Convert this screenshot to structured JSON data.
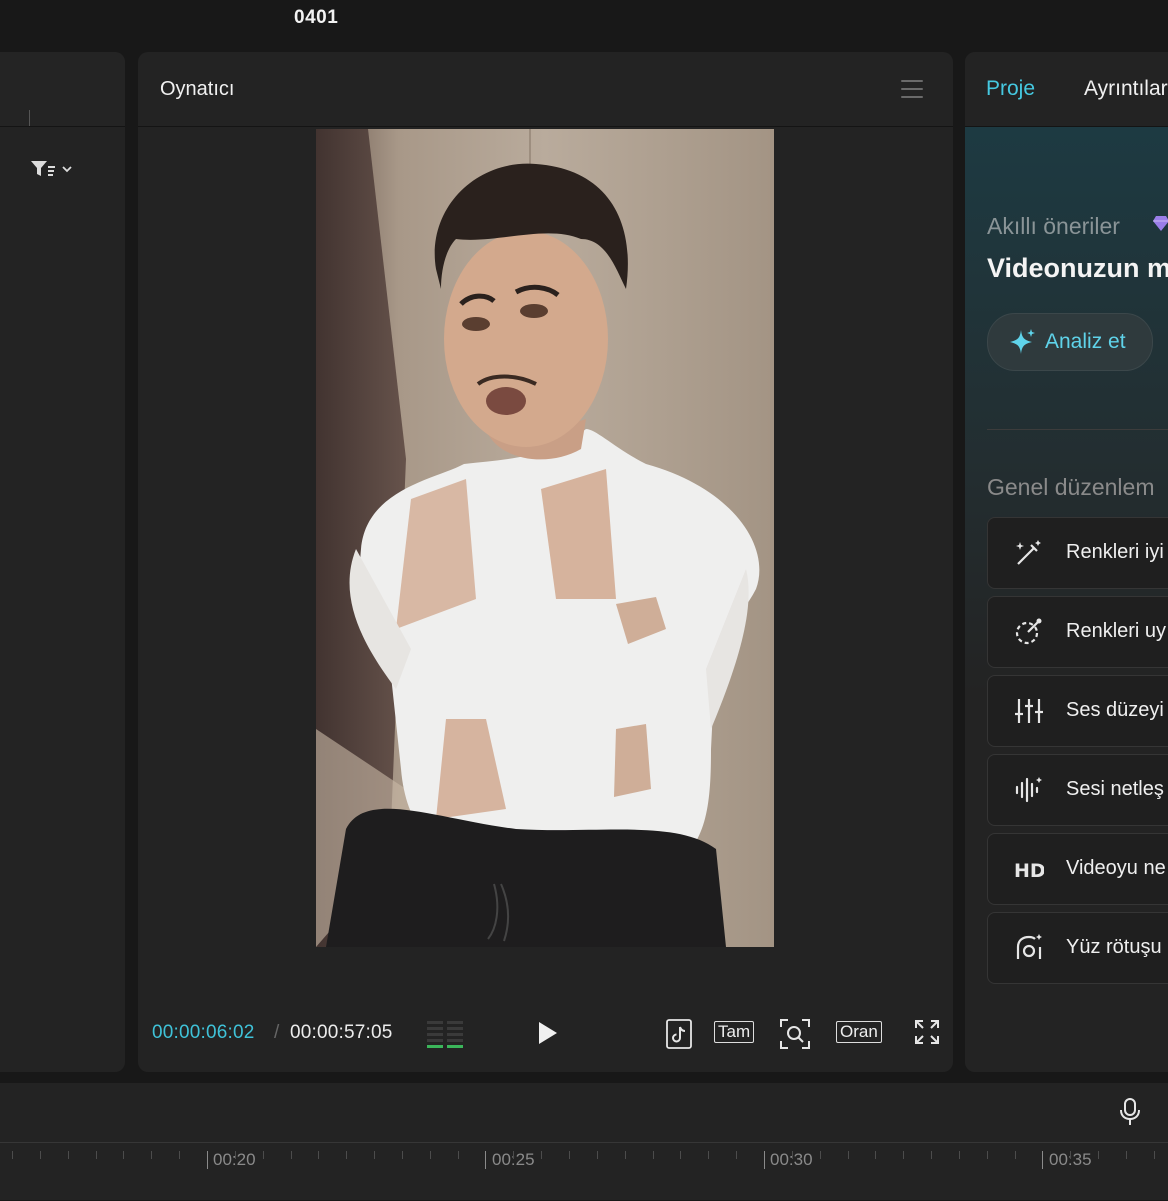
{
  "project": {
    "title": "0401"
  },
  "player": {
    "title": "Oynatıcı",
    "current_time": "00:00:06:02",
    "separator": "/",
    "total_time": "00:00:57:05",
    "full_label": "Tam",
    "ratio_label": "Oran"
  },
  "right_panel": {
    "tabs": [
      {
        "label": "Proje",
        "active": true
      },
      {
        "label": "Ayrıntılar",
        "active": false
      }
    ],
    "smart": {
      "label": "Akıllı öneriler",
      "title": "Videonuzun m",
      "analyze_label": "Analiz et"
    },
    "general_label": "Genel düzenlem",
    "tools": [
      {
        "label": "Renkleri iyi",
        "icon": "magic-wand-icon"
      },
      {
        "label": "Renkleri uy",
        "icon": "color-match-icon"
      },
      {
        "label": "Ses düzeyi",
        "icon": "sliders-icon"
      },
      {
        "label": "Sesi netleş",
        "icon": "audio-wave-icon"
      },
      {
        "label": "Videoyu ne",
        "icon": "hd-icon"
      },
      {
        "label": "Yüz rötuşu",
        "icon": "face-retouch-icon"
      }
    ]
  },
  "timeline": {
    "labels": [
      "00:20",
      "00:25",
      "00:30",
      "00:35"
    ]
  },
  "colors": {
    "accent": "#45c8e0",
    "background": "#181818",
    "panel": "#232323"
  }
}
